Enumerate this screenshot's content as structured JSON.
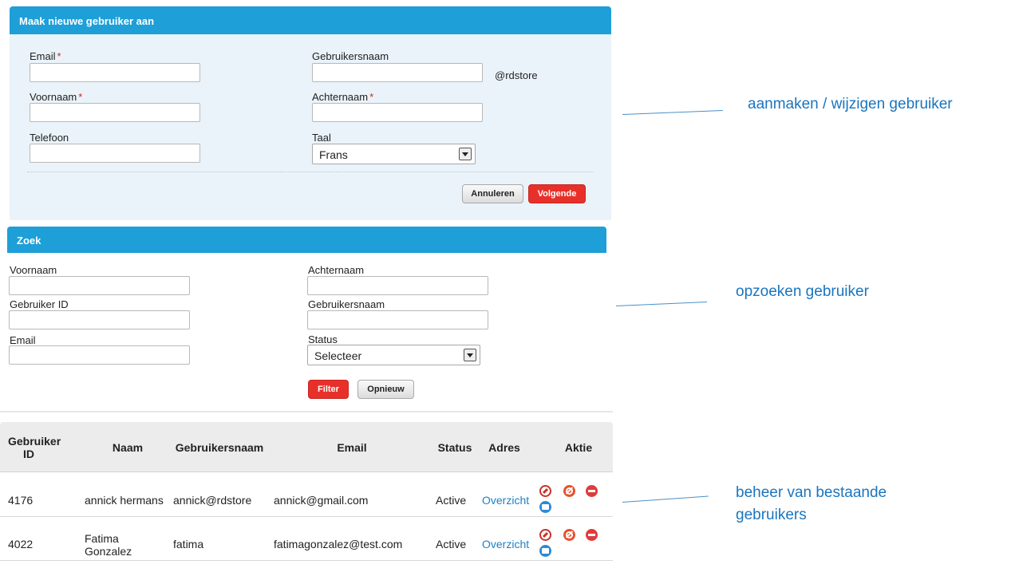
{
  "create_form": {
    "title": "Maak nieuwe gebruiker aan",
    "email_label": "Email",
    "voornaam_label": "Voornaam",
    "telefoon_label": "Telefoon",
    "gebruikersnaam_label": "Gebruikersnaam",
    "username_suffix": "@rdstore",
    "achternaam_label": "Achternaam",
    "taal_label": "Taal",
    "taal_value": "Frans",
    "required_mark": "*",
    "cancel_label": "Annuleren",
    "next_label": "Volgende"
  },
  "search_form": {
    "title": "Zoek",
    "voornaam_label": "Voornaam",
    "gebruiker_id_label": "Gebruiker ID",
    "email_label": "Email",
    "achternaam_label": "Achternaam",
    "gebruikersnaam_label": "Gebruikersnaam",
    "status_label": "Status",
    "status_value": "Selecteer",
    "filter_label": "Filter",
    "reset_label": "Opnieuw"
  },
  "users_table": {
    "columns": {
      "id_line1": "Gebruiker",
      "id_line2": "ID",
      "naam": "Naam",
      "gebruikersnaam": "Gebruikersnaam",
      "email": "Email",
      "status": "Status",
      "adres": "Adres",
      "aktie": "Aktie"
    },
    "rows": [
      {
        "id": "4176",
        "naam_line1": "annick hermans",
        "naam_line2": "",
        "gebruikersnaam": "annick@rdstore",
        "email": "annick@gmail.com",
        "status": "Active",
        "adres": "Overzicht"
      },
      {
        "id": "4022",
        "naam_line1": "Fatima",
        "naam_line2": "Gonzalez",
        "gebruikersnaam": "fatima",
        "email": "fatimagonzalez@test.com",
        "status": "Active",
        "adres": "Overzicht"
      }
    ]
  },
  "annotations": {
    "create": "aanmaken / wijzigen gebruiker",
    "search": "opzoeken gebruiker",
    "manage_line1": "beheer van bestaande",
    "manage_line2": "gebruikers"
  },
  "colors": {
    "header_blue": "#1e9fd8",
    "panel_bg": "#eaf3fa",
    "primary_red": "#e8302a",
    "link_blue": "#1e7fc4",
    "annotation_blue": "#1a75bf"
  }
}
